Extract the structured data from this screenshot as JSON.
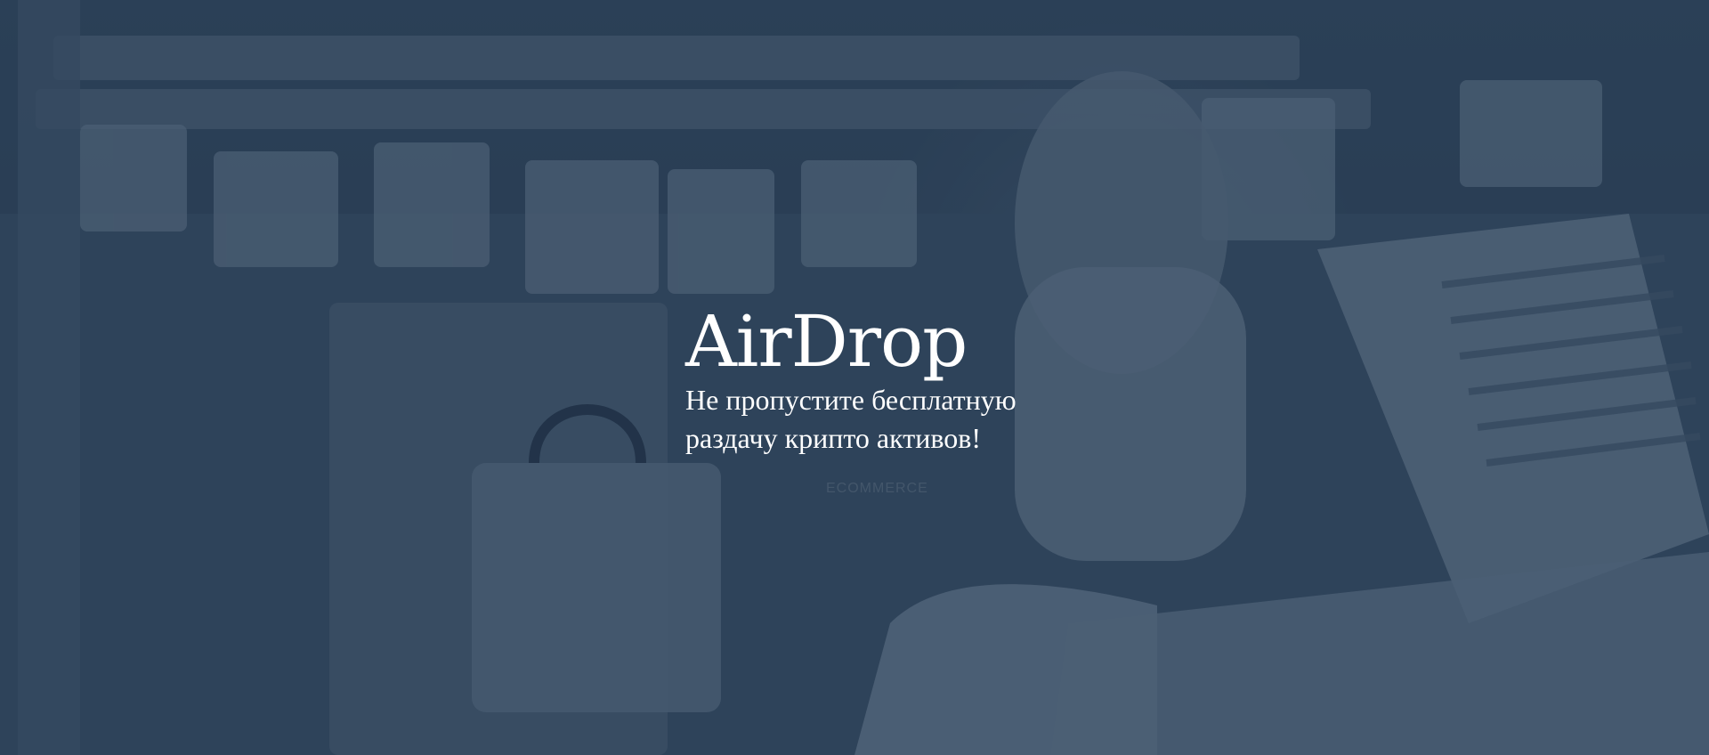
{
  "hero": {
    "title": "AirDrop",
    "subtitle_line1": "Не пропустите бесплатную",
    "subtitle_line2": "раздачу крипто активов!"
  },
  "colors": {
    "overlay": "#243850",
    "text": "#ffffff"
  }
}
